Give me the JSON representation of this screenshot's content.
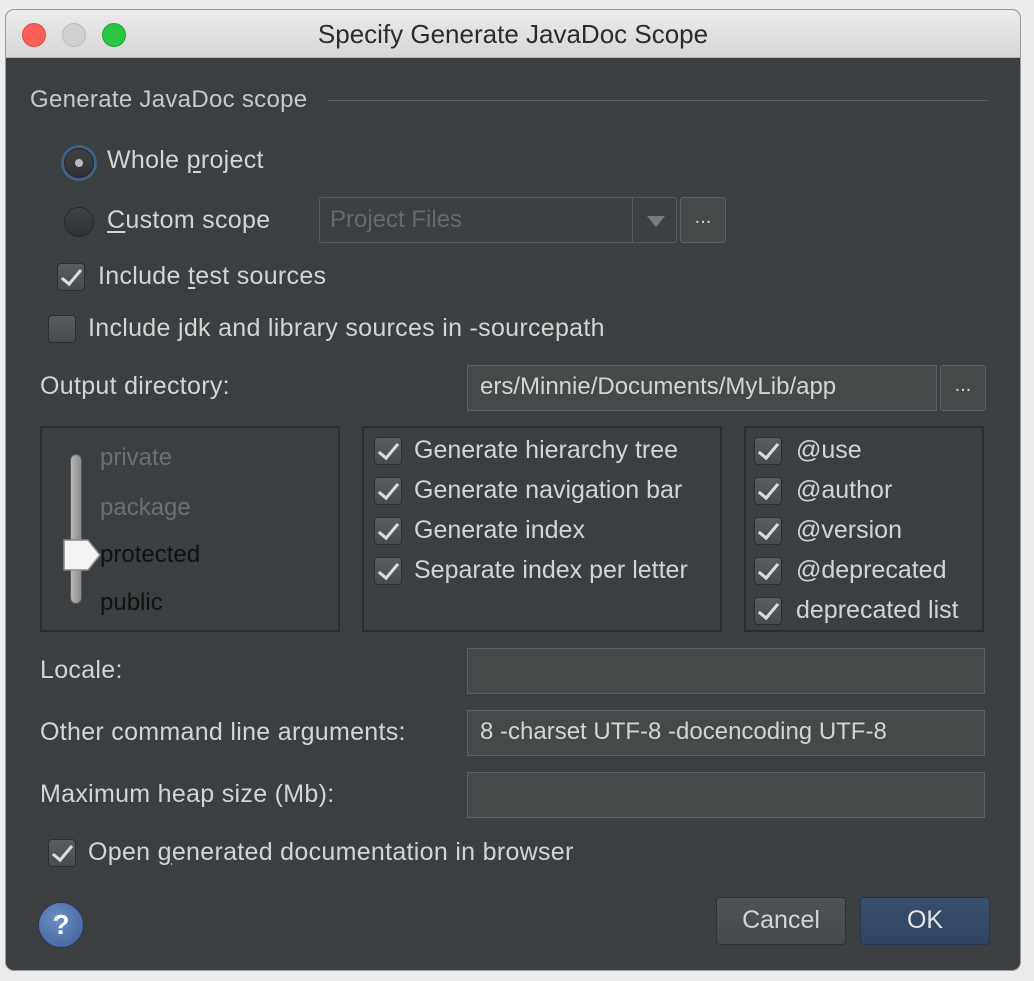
{
  "window": {
    "title": "Specify Generate JavaDoc Scope"
  },
  "scope": {
    "group_label": "Generate JavaDoc scope",
    "whole_project": {
      "pre": "Whole ",
      "mnemonic": "p",
      "post": "roject",
      "selected": true
    },
    "custom_scope": {
      "pre": "",
      "mnemonic": "C",
      "post": "ustom scope",
      "selected": false
    },
    "custom_scope_combo": "Project Files",
    "include_test": {
      "pre": "Include ",
      "mnemonic": "t",
      "post": "est sources",
      "checked": true
    },
    "include_jdk": {
      "label": "Include jdk and library sources in -sourcepath",
      "checked": false
    }
  },
  "output": {
    "label": "Output directory:",
    "value": "ers/Minnie/Documents/MyLib/app"
  },
  "visibility": {
    "levels": [
      "private",
      "package",
      "protected",
      "public"
    ],
    "selected": "protected"
  },
  "generate_options": [
    {
      "label": "Generate hierarchy tree",
      "checked": true
    },
    {
      "label": "Generate navigation bar",
      "checked": true
    },
    {
      "label": "Generate index",
      "checked": true
    },
    {
      "label": "Separate index per letter",
      "checked": true
    }
  ],
  "tag_options": [
    {
      "label": "@use",
      "checked": true
    },
    {
      "label": "@author",
      "checked": true
    },
    {
      "label": "@version",
      "checked": true
    },
    {
      "label": "@deprecated",
      "checked": true
    },
    {
      "label": "deprecated list",
      "checked": true
    }
  ],
  "locale": {
    "label": "Locale:",
    "value": ""
  },
  "args": {
    "label": "Other command line arguments:",
    "value": "8 -charset UTF-8 -docencoding UTF-8"
  },
  "heap": {
    "label": "Maximum heap size (Mb):",
    "value": ""
  },
  "open_browser": {
    "pre": "Open ",
    "mnemonic": "g",
    "post": "enerated documentation in browser",
    "checked": true
  },
  "buttons": {
    "help": "?",
    "cancel": "Cancel",
    "ok": "OK",
    "ellipsis": "..."
  },
  "colors": {
    "background": "#3c3f41",
    "ok_button": "#2f4462",
    "focus_ring": "#3d6187"
  }
}
